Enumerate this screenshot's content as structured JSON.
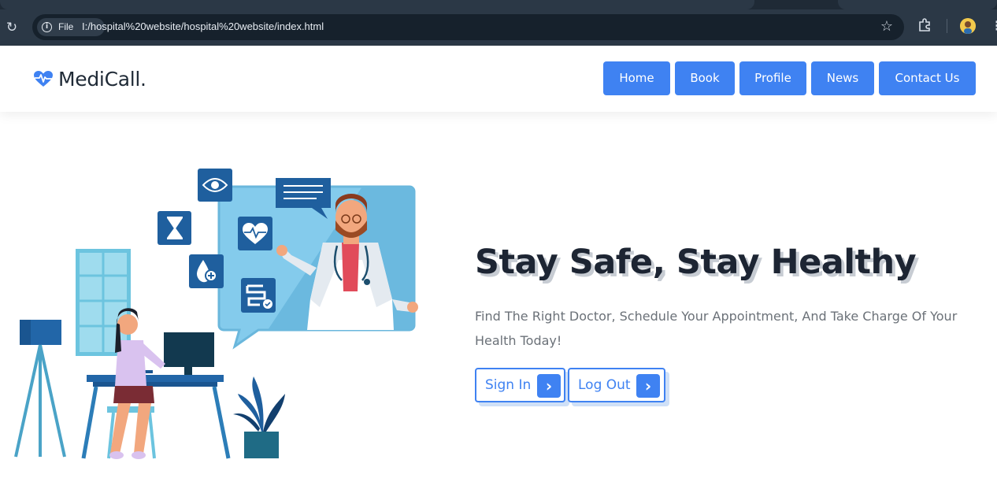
{
  "browser": {
    "chip_label": "File",
    "url": "I:/hospital%20website/hospital%20website/index.html"
  },
  "site": {
    "brand": "MediCall.",
    "nav": [
      {
        "label": "Home"
      },
      {
        "label": "Book"
      },
      {
        "label": "Profile"
      },
      {
        "label": "News"
      },
      {
        "label": "Contact Us"
      }
    ]
  },
  "hero": {
    "title": "Stay Safe, Stay Healthy",
    "subtitle": "Find The Right Doctor, Schedule Your Appointment, And Take Charge Of Your Health Today!",
    "buttons": [
      {
        "label": "Sign In",
        "icon": "chevron-right-icon"
      },
      {
        "label": "Log Out",
        "icon": "chevron-right-icon"
      }
    ]
  },
  "colors": {
    "accent": "#3f82f2",
    "title": "#1d2533",
    "browser_toolbar": "#2b3846"
  }
}
